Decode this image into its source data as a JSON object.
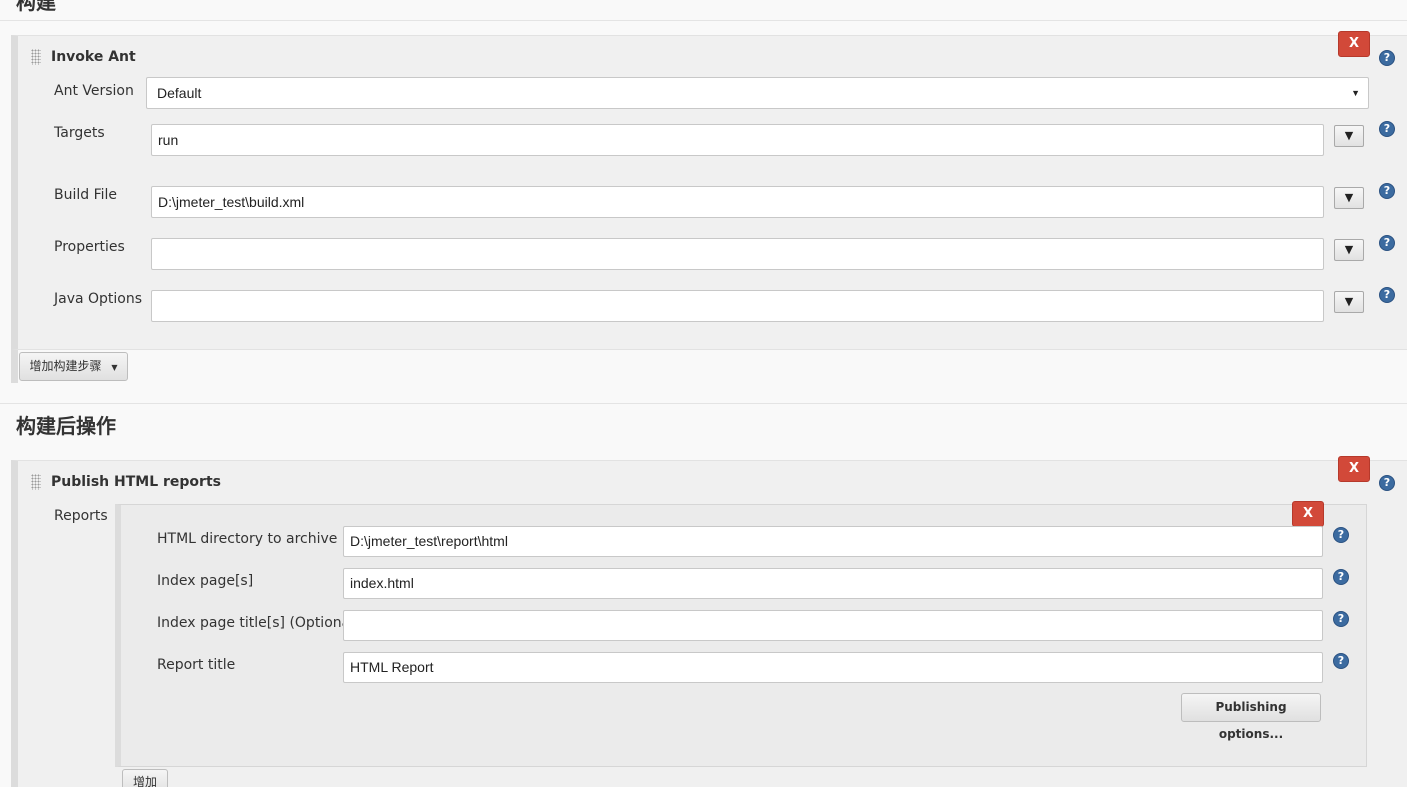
{
  "sections": {
    "build": "构建",
    "post_build": "构建后操作"
  },
  "invoke_ant": {
    "title": "Invoke Ant",
    "delete_label": "X",
    "help_glyph": "?",
    "fields": {
      "ant_version": {
        "label": "Ant Version",
        "value": "Default"
      },
      "targets": {
        "label": "Targets",
        "value": "run"
      },
      "build_file": {
        "label": "Build File",
        "value": "D:\\jmeter_test\\build.xml"
      },
      "properties": {
        "label": "Properties",
        "value": ""
      },
      "java_options": {
        "label": "Java Options",
        "value": ""
      }
    },
    "expand_glyph": "▼"
  },
  "add_build_step": {
    "label": "增加构建步骤"
  },
  "publish_html": {
    "title": "Publish HTML reports",
    "delete_label": "X",
    "reports_label": "Reports",
    "report": {
      "delete_label": "X",
      "html_dir": {
        "label": "HTML directory to archive",
        "value": "D:\\jmeter_test\\report\\html"
      },
      "index_pages": {
        "label": "Index page[s]",
        "value": "index.html"
      },
      "index_titles": {
        "label": "Index page title[s] (Optional)",
        "value": ""
      },
      "report_title": {
        "label": "Report title",
        "value": "HTML Report"
      },
      "publishing_options": "Publishing options..."
    },
    "add_label": "增加"
  },
  "colors": {
    "delete_red": "#d24939",
    "help_blue": "#3c6ba0",
    "panel_bg": "#f0f0f0"
  },
  "icons": [
    "drag-handle-icon",
    "delete-icon",
    "help-icon",
    "dropdown-caret-icon",
    "expand-arrow-icon"
  ]
}
